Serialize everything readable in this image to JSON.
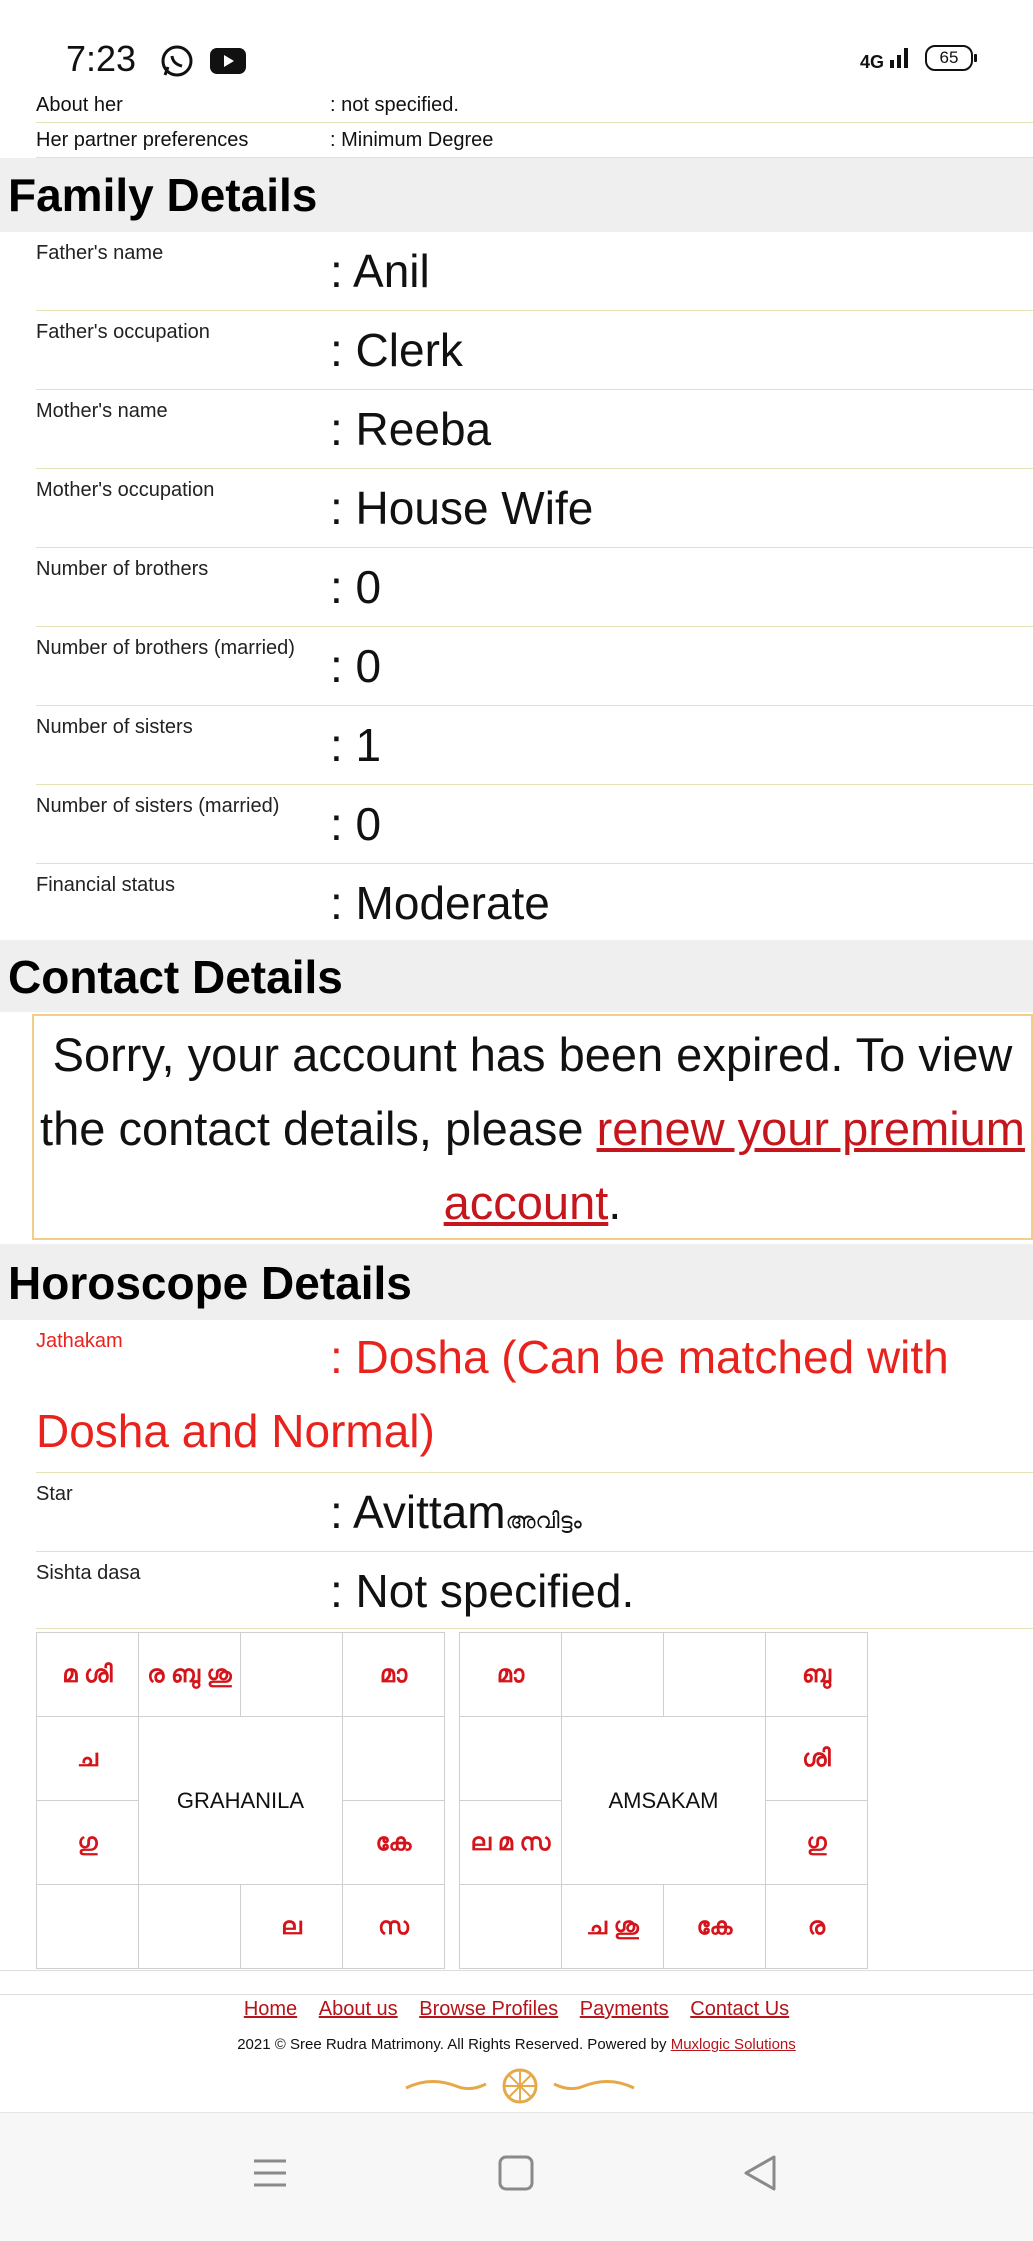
{
  "status_bar": {
    "time": "7:23",
    "network": "4G",
    "battery": "65",
    "icons": [
      "whatsapp-icon",
      "youtube-icon",
      "signal-icon",
      "battery-icon"
    ]
  },
  "about": {
    "rows": [
      {
        "label": "About her",
        "value": ": not specified."
      },
      {
        "label": "Her partner preferences",
        "value": ": Minimum Degree"
      }
    ]
  },
  "family": {
    "title": "Family Details",
    "rows": [
      {
        "label": "Father's name",
        "value": ": Anil"
      },
      {
        "label": "Father's occupation",
        "value": ": Clerk"
      },
      {
        "label": "Mother's name",
        "value": ": Reeba"
      },
      {
        "label": "Mother's occupation",
        "value": ": House Wife"
      },
      {
        "label": "Number of brothers",
        "value": ": 0"
      },
      {
        "label": "Number of brothers (married)",
        "value": ": 0"
      },
      {
        "label": "Number of sisters",
        "value": ": 1"
      },
      {
        "label": "Number of sisters (married)",
        "value": ": 0"
      },
      {
        "label": "Financial status",
        "value": ": Moderate"
      }
    ]
  },
  "contact": {
    "title": "Contact Details",
    "notice_text": "Sorry, your account has been expired. To view the contact details, please",
    "renew_link": "renew your premium account",
    "notice_end": "."
  },
  "horoscope": {
    "title": "Horoscope Details",
    "jathakam_label": "Jathakam",
    "jathakam_value": ": Dosha (Can be matched with",
    "jathakam_value2": "Dosha and Normal)",
    "star_label": "Star",
    "star_value": ": Avittam",
    "star_malayalam": "അവിട്ടം",
    "sishta_label": "Sishta dasa",
    "sishta_value": ": Not specified.",
    "grahanila": {
      "center_label": "GRAHANILA",
      "top": [
        "മ ശി",
        "ര ബു ശു",
        "",
        "മാ"
      ],
      "left": [
        "ച",
        "ഗു"
      ],
      "right": [
        "",
        "കേ"
      ],
      "bottom": [
        "",
        "",
        "ല",
        "സ"
      ]
    },
    "amsakam": {
      "center_label": "AMSAKAM",
      "top": [
        "മാ",
        "",
        "",
        "ബു"
      ],
      "left": [
        "",
        "ല മ സ"
      ],
      "right": [
        "ശി",
        "ഗു"
      ],
      "bottom": [
        "",
        "ച ശു",
        "കേ",
        "ര"
      ]
    }
  },
  "footer": {
    "links": [
      "Home",
      "About us",
      "Browse Profiles",
      "Payments",
      "Contact Us"
    ],
    "copyright": "2021 © Sree Rudra Matrimony. All Rights Reserved. Powered by",
    "powered_link": "Muxlogic Solutions"
  },
  "colors": {
    "accent_red": "#e8221d",
    "link_red": "#b4141a",
    "section_bg": "#efefef",
    "notice_border": "#f1cf86"
  }
}
